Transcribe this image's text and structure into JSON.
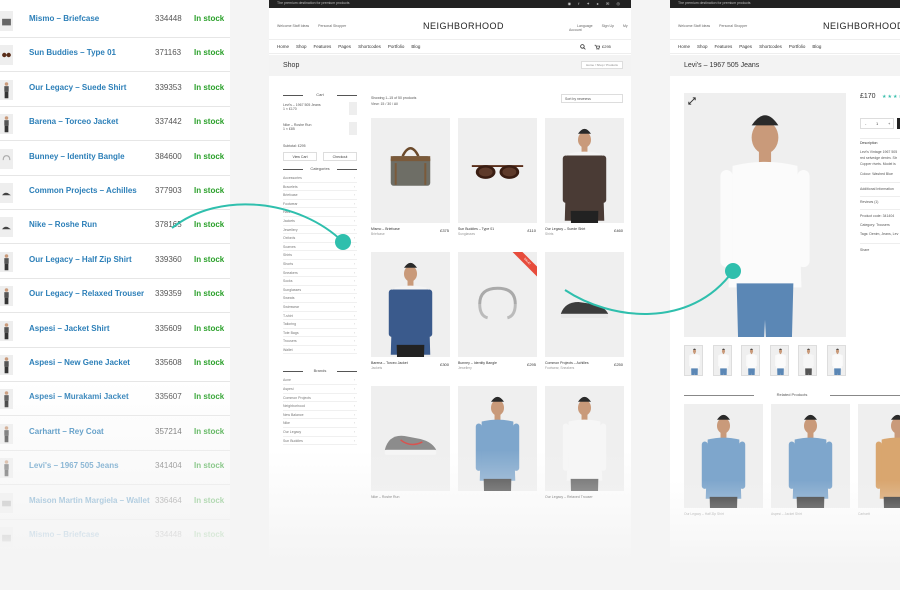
{
  "product_list": [
    {
      "name": "Mismo – Briefcase",
      "sku": "334448",
      "stock": "In stock",
      "icon": "bag-icon"
    },
    {
      "name": "Sun Buddies – Type 01",
      "sku": "371163",
      "stock": "In stock",
      "icon": "sunglasses-icon"
    },
    {
      "name": "Our Legacy – Suede Shirt",
      "sku": "339353",
      "stock": "In stock",
      "icon": "person-icon"
    },
    {
      "name": "Barena – Torceo Jacket",
      "sku": "337442",
      "stock": "In stock",
      "icon": "person-icon"
    },
    {
      "name": "Bunney – Identity Bangle",
      "sku": "384600",
      "stock": "In stock",
      "icon": "bangle-icon"
    },
    {
      "name": "Common Projects – Achilles",
      "sku": "377903",
      "stock": "In stock",
      "icon": "shoe-icon"
    },
    {
      "name": "Nike – Roshe Run",
      "sku": "378165",
      "stock": "In stock",
      "icon": "shoe-icon"
    },
    {
      "name": "Our Legacy – Half Zip Shirt",
      "sku": "339360",
      "stock": "In stock",
      "icon": "person-icon"
    },
    {
      "name": "Our Legacy – Relaxed Trouser",
      "sku": "339359",
      "stock": "In stock",
      "icon": "person-icon"
    },
    {
      "name": "Aspesi – Jacket Shirt",
      "sku": "335609",
      "stock": "In stock",
      "icon": "person-icon"
    },
    {
      "name": "Aspesi – New Gene Jacket",
      "sku": "335608",
      "stock": "In stock",
      "icon": "person-icon"
    },
    {
      "name": "Aspesi – Murakami Jacket",
      "sku": "335607",
      "stock": "In stock",
      "icon": "person-icon"
    },
    {
      "name": "Carhartt – Rey Coat",
      "sku": "357214",
      "stock": "In stock",
      "icon": "person-icon"
    },
    {
      "name": "Levi's – 1967 505 Jeans",
      "sku": "341404",
      "stock": "In stock",
      "icon": "person-icon"
    },
    {
      "name": "Maison Martin Margiela – Wallet",
      "sku": "336464",
      "stock": "In stock",
      "icon": "wallet-icon"
    },
    {
      "name": "Mismo – Briefcase",
      "sku": "334448",
      "stock": "In stock",
      "icon": "bag-icon"
    }
  ],
  "shop": {
    "topbar_text": "The premium destination for premium products",
    "welcome": "Welcome Staff Ideas",
    "personal_shopper": "Personal Shopper",
    "brand": "NEIGHBORHOOD",
    "language": "Language",
    "signup": "Sign Up",
    "my_account": "My Account",
    "nav": [
      "Home",
      "Shop",
      "Features",
      "Pages",
      "Shortcodes",
      "Portfolio",
      "Blog"
    ],
    "cart_value": "£295",
    "title": "Shop",
    "breadcrumb": "Home / Shop / Products",
    "cart_heading": "Cart",
    "mini_cart": [
      {
        "name": "Levi's – 1967 505 Jeans",
        "qty": "1 × £170"
      },
      {
        "name": "Nike – Roshe Run",
        "qty": "1 × £85"
      }
    ],
    "subtotal": "Subtotal: £295",
    "view_cart": "View Cart",
    "checkout": "Checkout",
    "categories_heading": "Categories",
    "categories": [
      "Accessories",
      "Bracelets",
      "Briefcase",
      "Footwear",
      "Hats",
      "Jackets",
      "Jewellery",
      "Oxfords",
      "Scarves",
      "Shirts",
      "Shorts",
      "Sneakers",
      "Socks",
      "Sunglasses",
      "Sweats",
      "Swimwear",
      "T-shirt",
      "Tailoring",
      "Tote Bags",
      "Trousers",
      "Wallet"
    ],
    "brands_heading": "Brands",
    "brands": [
      "Acne",
      "Aspesi",
      "Common Projects",
      "Neighborhood",
      "New Balance",
      "Nike",
      "Our Legacy",
      "Sun Buddies"
    ],
    "showing": "Showing 1–15 of 50 products",
    "view": "View: 15 / 30 / All",
    "sort": "Sort by newness",
    "products": [
      {
        "name": "Mismo – Briefcase",
        "cat": "Briefcase",
        "price": "£375",
        "img": "bag"
      },
      {
        "name": "Sun Buddies – Type 01",
        "cat": "Sunglasses",
        "price": "£110",
        "img": "sunglasses"
      },
      {
        "name": "Our Legacy – Suede Shirt",
        "cat": "Shirts",
        "price": "£460",
        "img": "model-dark"
      },
      {
        "name": "Barena – Torceo Jacket",
        "cat": "Jackets",
        "price": "£300",
        "img": "model-blue"
      },
      {
        "name": "Bunney – Identity Bangle",
        "cat": "Jewellery",
        "price": "£295",
        "img": "bangle",
        "sale": "SALE!"
      },
      {
        "name": "Common Projects – Achilles",
        "cat": "Footwear, Sneakers",
        "price": "£250",
        "img": "shoe"
      },
      {
        "name": "Nike – Roshe Run",
        "cat": "",
        "price": "",
        "img": "sneaker"
      },
      {
        "name": "",
        "cat": "",
        "price": "",
        "img": "model-shirt"
      },
      {
        "name": "Our Legacy – Relaxed Trouser",
        "cat": "",
        "price": "",
        "img": "model-white"
      }
    ]
  },
  "product_page": {
    "topbar_text": "The premium destination for premium products",
    "welcome": "Welcome Staff Ideas",
    "personal_shopper": "Personal Shopper",
    "brand": "NEIGHBORHOOD",
    "nav": [
      "Home",
      "Shop",
      "Features",
      "Pages",
      "Shortcodes",
      "Portfolio",
      "Blog"
    ],
    "title": "Levi's – 1967 505 Jeans",
    "price": "£170",
    "stars": "★★★★★",
    "qty_minus": "-",
    "qty_value": "1",
    "qty_plus": "+",
    "description_label": "Description",
    "description_lines": [
      "Levi's Vintage 1967 505",
      "red selvedge denim. Str",
      "Copper rivets. Model is"
    ],
    "colour": "Colour: Washed Blue",
    "additional_info": "Additional Information",
    "reviews": "Reviews (1)",
    "product_code": "Product code: 341404",
    "category": "Category: Trousers",
    "tags": "Tags: Denim, Jeans, Lev",
    "share": "Share",
    "related_heading": "Related Products",
    "related": [
      {
        "name": "Our Legacy – Half Zip Shirt",
        "img": "model-shirt"
      },
      {
        "name": "Aspesi – Jacket Shirt",
        "img": "model-shirt"
      },
      {
        "name": "Carhartt",
        "img": "model-tan"
      }
    ]
  },
  "colors": {
    "link_blue": "#2c7fb8",
    "stock_green": "#2aa02a",
    "accent_teal": "#2fbfad",
    "sale_red": "#e74c3c"
  }
}
